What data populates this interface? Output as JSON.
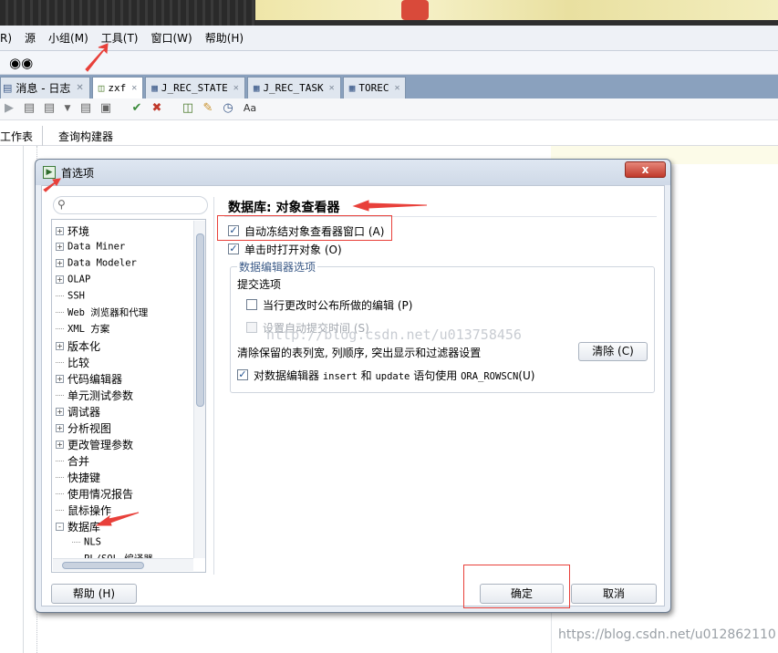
{
  "menubar": {
    "items": [
      "R)",
      "源",
      "小组(M)",
      "工具(T)",
      "窗口(W)",
      "帮助(H)"
    ]
  },
  "toolbar1": {
    "icon": "binoculars-icon",
    "dash": "-"
  },
  "doc_tabs": [
    {
      "label": "消息 - 日志",
      "icon": "list-icon"
    },
    {
      "label": "zxf",
      "icon": "sql-icon",
      "active": true
    },
    {
      "label": "J_REC_STATE",
      "icon": "table-icon"
    },
    {
      "label": "J_REC_TASK",
      "icon": "table-icon"
    },
    {
      "label": "TOREC",
      "icon": "table-icon"
    }
  ],
  "subtabs": [
    "工作表",
    "查询构建器"
  ],
  "dialog": {
    "title": "首选项",
    "close_label": "x",
    "tree": {
      "items": [
        {
          "label": "环境",
          "toggle": "+"
        },
        {
          "label": "Data Miner",
          "toggle": "+"
        },
        {
          "label": "Data Modeler",
          "toggle": "+"
        },
        {
          "label": "OLAP",
          "toggle": "+"
        },
        {
          "label": "SSH",
          "toggle": ""
        },
        {
          "label": "Web 浏览器和代理",
          "toggle": ""
        },
        {
          "label": "XML 方案",
          "toggle": ""
        },
        {
          "label": "版本化",
          "toggle": "+"
        },
        {
          "label": "比较",
          "toggle": ""
        },
        {
          "label": "代码编辑器",
          "toggle": "+"
        },
        {
          "label": "单元测试参数",
          "toggle": ""
        },
        {
          "label": "调试器",
          "toggle": "+"
        },
        {
          "label": "分析视图",
          "toggle": "+"
        },
        {
          "label": "更改管理参数",
          "toggle": "+"
        },
        {
          "label": "合并",
          "toggle": ""
        },
        {
          "label": "快捷键",
          "toggle": ""
        },
        {
          "label": "使用情况报告",
          "toggle": ""
        },
        {
          "label": "鼠标操作",
          "toggle": ""
        },
        {
          "label": "数据库",
          "toggle": "-"
        },
        {
          "label": "NLS",
          "toggle": "",
          "child": true
        },
        {
          "label": "PL/SQL 编译器",
          "toggle": "",
          "child": true
        }
      ]
    },
    "panel": {
      "title": "数据库: 对象查看器",
      "auto_freeze": {
        "label": "自动冻结对象查看器窗口 (A)",
        "checked": true
      },
      "single_click": {
        "label": "单击时打开对象 (O)",
        "checked": true
      },
      "group_title": "数据编辑器选项",
      "commit_options": "提交选项",
      "post_edits": {
        "label": "当行更改时公布所做的编辑 (P)",
        "checked": false
      },
      "auto_commit": {
        "label": "设置自动提交时间 (S)",
        "checked": false
      },
      "clear_text": "清除保留的表列宽, 列顺序, 突出显示和过滤器设置",
      "clear_button": "清除 (C)",
      "ora_rowscn": {
        "label_pre": "对数据编辑器",
        "kw1": "insert",
        "mid": "和",
        "kw2": "update",
        "label_post": "语句使用",
        "kw3": "ORA_ROWSCN",
        "hotkey": "(U)",
        "checked": true
      },
      "watermark": "http://blog.csdn.net/u013758456"
    },
    "help_button": "帮助 (H)",
    "ok_button": "确定",
    "cancel_button": "取消"
  },
  "watermark_bottom": "https://blog.csdn.net/u012862110",
  "colors": {
    "accent_red": "#e8403a",
    "tab_bar": "#8aa1be",
    "dialog_bg": "#e9eef5"
  }
}
